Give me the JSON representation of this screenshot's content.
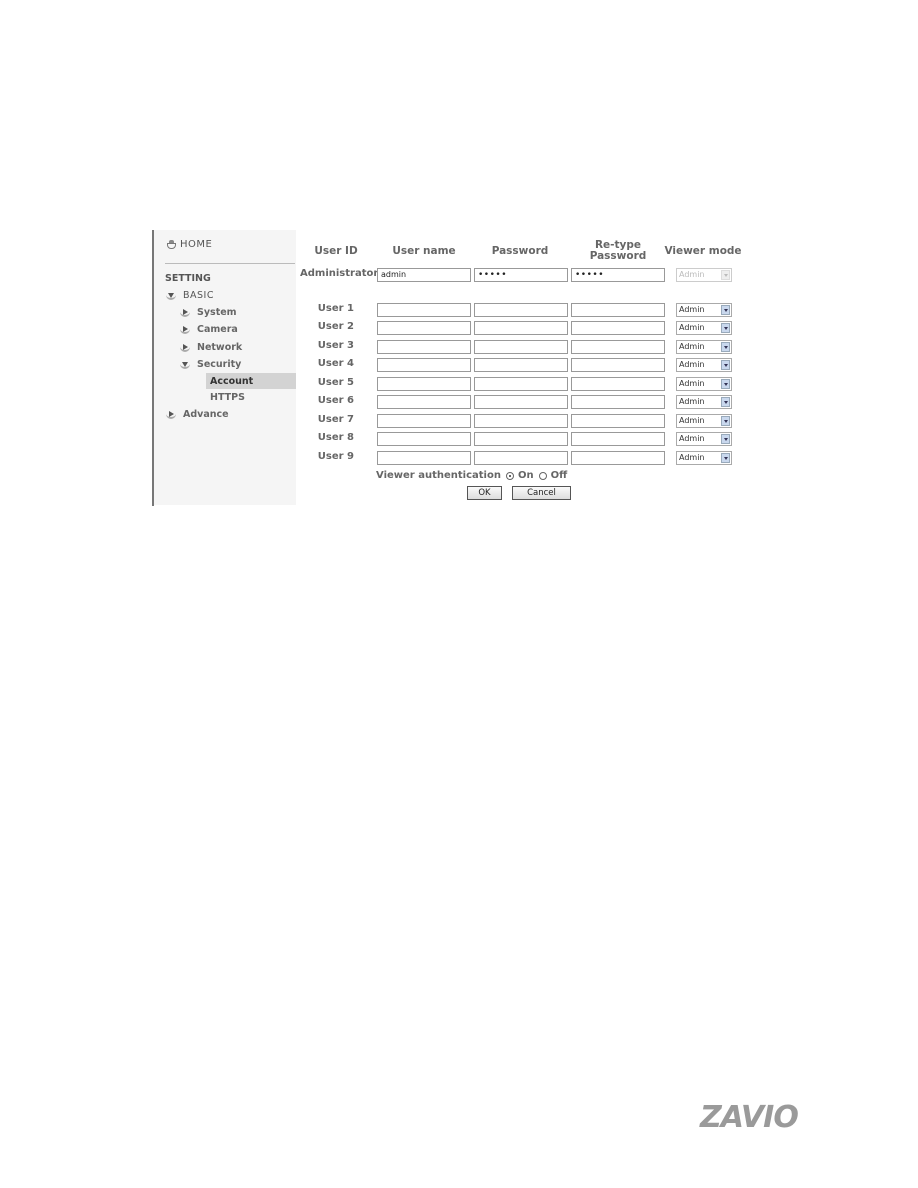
{
  "sidebar": {
    "home": "HOME",
    "setting": "SETTING",
    "basic": "BASIC",
    "items": [
      {
        "label": "System"
      },
      {
        "label": "Camera"
      },
      {
        "label": "Network"
      },
      {
        "label": "Security"
      }
    ],
    "security_sub": [
      {
        "label": "Account",
        "selected": true
      },
      {
        "label": "HTTPS"
      }
    ],
    "advance": "Advance"
  },
  "table": {
    "headers": {
      "user_id": "User ID",
      "user_name": "User name",
      "password": "Password",
      "retype_1": "Re-type",
      "retype_2": "Password",
      "viewer_mode": "Viewer mode"
    },
    "admin": {
      "label": "Administrator",
      "username": "admin",
      "password": "•••••",
      "retype": "•••••",
      "mode": "Admin"
    },
    "users": [
      {
        "label": "User 1",
        "username": "",
        "password": "",
        "retype": "",
        "mode": "Admin"
      },
      {
        "label": "User 2",
        "username": "",
        "password": "",
        "retype": "",
        "mode": "Admin"
      },
      {
        "label": "User 3",
        "username": "",
        "password": "",
        "retype": "",
        "mode": "Admin"
      },
      {
        "label": "User 4",
        "username": "",
        "password": "",
        "retype": "",
        "mode": "Admin"
      },
      {
        "label": "User 5",
        "username": "",
        "password": "",
        "retype": "",
        "mode": "Admin"
      },
      {
        "label": "User 6",
        "username": "",
        "password": "",
        "retype": "",
        "mode": "Admin"
      },
      {
        "label": "User 7",
        "username": "",
        "password": "",
        "retype": "",
        "mode": "Admin"
      },
      {
        "label": "User 8",
        "username": "",
        "password": "",
        "retype": "",
        "mode": "Admin"
      },
      {
        "label": "User 9",
        "username": "",
        "password": "",
        "retype": "",
        "mode": "Admin"
      }
    ]
  },
  "auth": {
    "label": "Viewer authentication",
    "on": "On",
    "off": "Off",
    "selected": "On"
  },
  "buttons": {
    "ok": "OK",
    "cancel": "Cancel"
  },
  "logo": "ZAVIO"
}
